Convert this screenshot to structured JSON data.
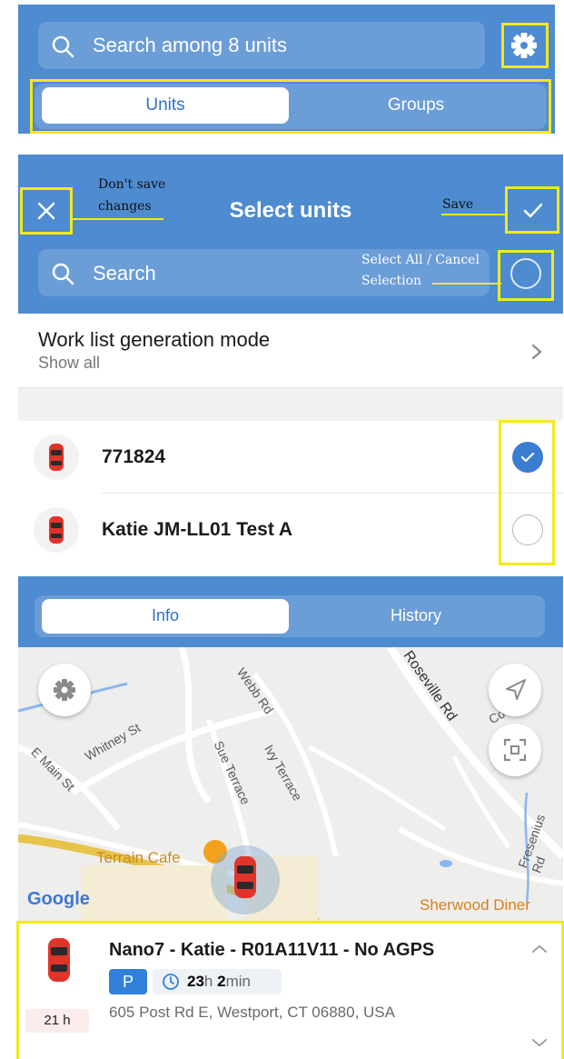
{
  "panel1": {
    "search_placeholder": "Search among 8 units",
    "tabs": [
      {
        "label": "Units",
        "active": true
      },
      {
        "label": "Groups",
        "active": false
      }
    ]
  },
  "panel2": {
    "title": "Select units",
    "search_placeholder": "Search",
    "annotations": {
      "close": "Don't save changes",
      "close_line1": "Don't save",
      "close_line2": "changes",
      "save": "Save",
      "select_all_line1": "Select All / Cancel",
      "select_all_line2": "Selection"
    },
    "work_list": {
      "title": "Work list generation mode",
      "subtitle": "Show all"
    },
    "units": [
      {
        "name": "771824",
        "selected": true
      },
      {
        "name": "Katie JM-LL01 Test A",
        "selected": false
      }
    ]
  },
  "panel3": {
    "tabs": [
      {
        "label": "Info",
        "active": true
      },
      {
        "label": "History",
        "active": false
      }
    ],
    "map": {
      "labels": [
        "Webb Rd",
        "Roseville Rd",
        "Whitney St",
        "E Main St",
        "Sue Terrace",
        "Ivy Terrace",
        "Fresenius Rd",
        "Co"
      ],
      "places": [
        "Terrain Cafe",
        "Sherwood Diner"
      ],
      "provider": "Google"
    },
    "card": {
      "unit_name": "Nano7 -  Katie - R01A11V11 - No AGPS",
      "status_badge": "P",
      "duration_hours": "23",
      "duration_hours_unit": "h",
      "duration_minutes": "2",
      "duration_minutes_unit": "min",
      "address": "605 Post Rd E, Westport, CT 06880, USA",
      "age": "21 h"
    }
  },
  "colors": {
    "header_blue": "#4e8bd0",
    "segment_blue": "#6b9dd7",
    "highlight_yellow": "#f2ea1a",
    "checkbox_blue": "#3b7dd1",
    "parking_badge": "#2f80d8"
  }
}
